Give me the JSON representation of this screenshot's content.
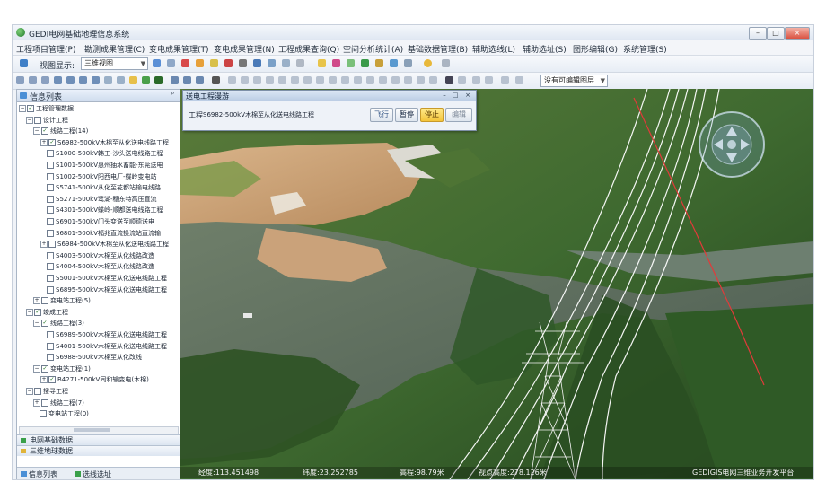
{
  "window": {
    "title": "GEDI电网基础地理信息系统",
    "controls": [
      "–",
      "□",
      "×"
    ]
  },
  "menu": [
    "工程项目管理(P)",
    "勘测成果管理(C)",
    "变电成果管理(T)",
    "变电成果管理(N)",
    "工程成果查询(Q)",
    "空间分析统计(A)",
    "基础数据管理(B)",
    "辅助选线(L)",
    "辅助选址(S)",
    "图形编辑(G)",
    "系统管理(S)"
  ],
  "toolbar": {
    "view_label": "视图显示:",
    "view_value": "三维视图",
    "edit_select": "没有可编辑图层"
  },
  "sidebar": {
    "title": "信息列表",
    "pin": "ᵖ",
    "tree": [
      {
        "level": 0,
        "exp": "−",
        "checked": true,
        "label": "工程管理数据"
      },
      {
        "level": 1,
        "exp": "−",
        "checked": false,
        "label": "设计工程"
      },
      {
        "level": 2,
        "exp": "−",
        "checked": true,
        "label": "线路工程(14)"
      },
      {
        "level": 3,
        "exp": "+",
        "checked": true,
        "label": "S6982-500kV木棉至从化送电线路工程"
      },
      {
        "level": 3,
        "exp": "",
        "checked": false,
        "label": "S1000-500kV韩工-沙头送电线路工程"
      },
      {
        "level": 3,
        "exp": "",
        "checked": false,
        "label": "S1001-500kV惠州抽水蓄能-东莞送电"
      },
      {
        "level": 3,
        "exp": "",
        "checked": false,
        "label": "S1002-500kV阳西电厂-蝶岭变电站"
      },
      {
        "level": 3,
        "exp": "",
        "checked": false,
        "label": "S5741-500kV从化至花都站输电线路"
      },
      {
        "level": 3,
        "exp": "",
        "checked": false,
        "label": "S5271-500kV鹭湖-穗东特高压直流"
      },
      {
        "level": 3,
        "exp": "",
        "checked": false,
        "label": "S4301-500kV蝶岭-顺都送电线路工程"
      },
      {
        "level": 3,
        "exp": "",
        "checked": false,
        "label": "S6901-500kV门头变送至顺德送电"
      },
      {
        "level": 3,
        "exp": "",
        "checked": false,
        "label": "S6801-500kV福兆直流换流站直流输"
      },
      {
        "level": 3,
        "exp": "+",
        "checked": false,
        "label": "S6984-500kV木棉至从化送电线路工程"
      },
      {
        "level": 3,
        "exp": "",
        "checked": false,
        "label": "S4003-500kV木棉至从化线路改造"
      },
      {
        "level": 3,
        "exp": "",
        "checked": false,
        "label": "S4004-500kV木棉至从化线路改造"
      },
      {
        "level": 3,
        "exp": "",
        "checked": false,
        "label": "S5001-500kV木棉至从化送电线路工程"
      },
      {
        "level": 3,
        "exp": "",
        "checked": false,
        "label": "S6895-500kV木棉至从化送电线路工程"
      },
      {
        "level": 2,
        "exp": "+",
        "checked": false,
        "label": "变电站工程(5)"
      },
      {
        "level": 1,
        "exp": "−",
        "checked": true,
        "label": "竣成工程"
      },
      {
        "level": 2,
        "exp": "−",
        "checked": true,
        "label": "线路工程(3)"
      },
      {
        "level": 3,
        "exp": "",
        "checked": false,
        "label": "S6989-500kV木棉至从化送电线路工程"
      },
      {
        "level": 3,
        "exp": "",
        "checked": false,
        "label": "S4001-500kV木棉至从化送电线路工程"
      },
      {
        "level": 3,
        "exp": "",
        "checked": false,
        "label": "S6988-500kV木棉至从化改线"
      },
      {
        "level": 2,
        "exp": "−",
        "checked": true,
        "label": "变电站工程(1)"
      },
      {
        "level": 3,
        "exp": "+",
        "checked": true,
        "label": "B4271-500kV同和输变电(木棉)"
      },
      {
        "level": 1,
        "exp": "−",
        "checked": false,
        "label": "搜寻工程"
      },
      {
        "level": 2,
        "exp": "+",
        "checked": false,
        "label": "线路工程(7)"
      },
      {
        "level": 2,
        "exp": "",
        "checked": false,
        "label": "变电站工程(0)"
      }
    ],
    "bottom_tabs": [
      "电网基础数据",
      "三维地球数据"
    ],
    "footer_tabs": [
      "信息列表",
      "选线选址"
    ]
  },
  "dialog": {
    "title": "送电工程漫游",
    "label": "工程",
    "project": "S6982-500kV木棉至从化送电线路工程",
    "buttons": [
      "飞行",
      "暂停",
      "停止",
      "编辑"
    ]
  },
  "status": {
    "longitude": "经度:113.451498",
    "latitude": "纬度:23.252785",
    "elevation": "高程:98.79米",
    "view_height": "视点高度:278.126米",
    "brand": "GEDIGIS电网三维业务开发平台"
  },
  "colors": {
    "accent": "#ffd84a",
    "power_lines": "#ffffff",
    "boundary": "#e23a3a"
  }
}
